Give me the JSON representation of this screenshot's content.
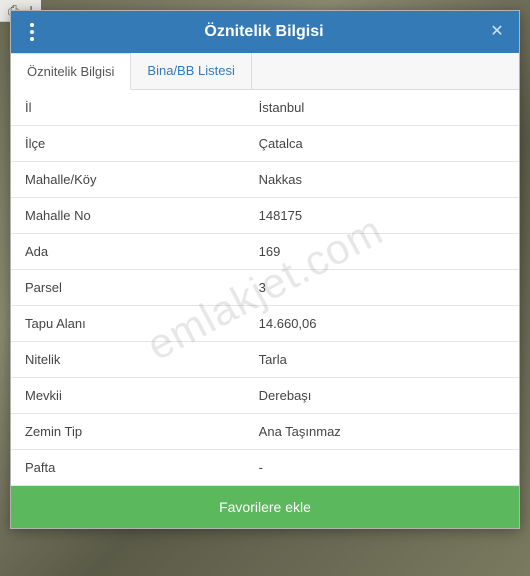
{
  "watermark": "emlakjet.com",
  "header": {
    "title": "Öznitelik Bilgisi"
  },
  "tabs": [
    {
      "label": "Öznitelik Bilgisi",
      "active": true
    },
    {
      "label": "Bina/BB Listesi",
      "active": false
    }
  ],
  "rows": [
    {
      "key": "İl",
      "value": "İstanbul"
    },
    {
      "key": "İlçe",
      "value": "Çatalca"
    },
    {
      "key": "Mahalle/Köy",
      "value": "Nakkas"
    },
    {
      "key": "Mahalle No",
      "value": "148175"
    },
    {
      "key": "Ada",
      "value": "169"
    },
    {
      "key": "Parsel",
      "value": "3"
    },
    {
      "key": "Tapu Alanı",
      "value": "14.660,06"
    },
    {
      "key": "Nitelik",
      "value": "Tarla"
    },
    {
      "key": "Mevkii",
      "value": "Derebaşı"
    },
    {
      "key": "Zemin Tip",
      "value": "Ana Taşınmaz"
    },
    {
      "key": "Pafta",
      "value": "-"
    }
  ],
  "footer": {
    "favorite_label": "Favorilere ekle"
  }
}
